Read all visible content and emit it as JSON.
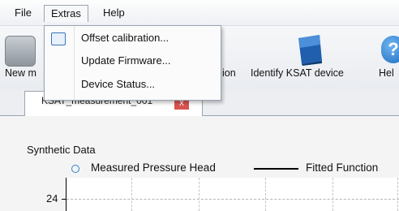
{
  "menubar": {
    "items": [
      {
        "label": "File"
      },
      {
        "label": "Extras"
      },
      {
        "label": "Help"
      }
    ]
  },
  "toolbar": {
    "new_label": "New m",
    "calibration_label": "ion",
    "identify_label": "Identify KSAT device",
    "help_label": "Hel",
    "help_icon_glyph": "?"
  },
  "extras_menu": {
    "items": [
      {
        "label": "Offset calibration...",
        "icon": "calibration-icon"
      },
      {
        "label": "Update Firmware..."
      },
      {
        "label": "Device Status..."
      }
    ]
  },
  "tabs": [
    {
      "label": "KSAT_measurement_001",
      "close_glyph": "x"
    }
  ],
  "chart": {
    "title": "Synthetic Data",
    "legend": [
      {
        "label": "Measured Pressure Head",
        "marker": "circle",
        "color": "#2f7fd0"
      },
      {
        "label": "Fitted Function",
        "marker": "line",
        "color": "#000000"
      }
    ],
    "y_tick": "24"
  }
}
